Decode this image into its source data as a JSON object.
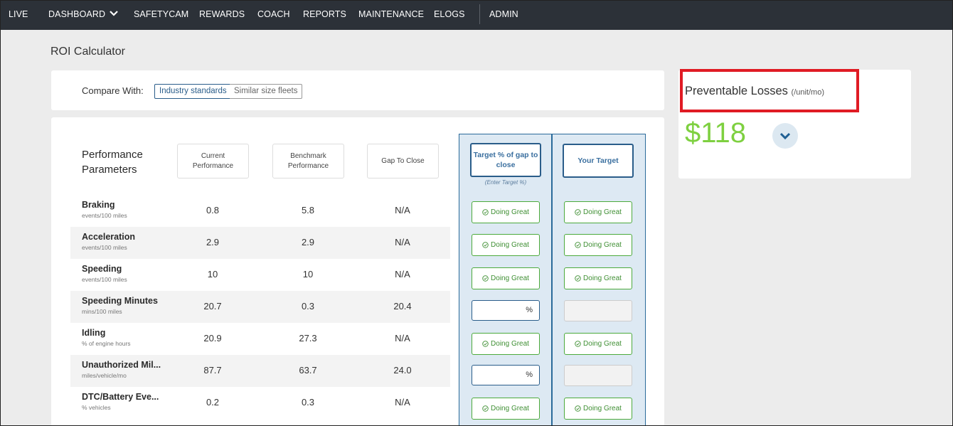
{
  "nav": {
    "items": [
      "LIVE",
      "DASHBOARD",
      "SAFETYCAM",
      "REWARDS",
      "COACH",
      "REPORTS",
      "MAINTENANCE",
      "ELOGS",
      "ADMIN"
    ],
    "dropdown_icon": "chevron-down-icon"
  },
  "page": {
    "title": "ROI Calculator"
  },
  "compare": {
    "label": "Compare With:",
    "options": [
      "Industry standards",
      "Similar size fleets"
    ],
    "selected": "Industry standards"
  },
  "table": {
    "title_line1": "Performance",
    "title_line2": "Parameters",
    "headers": {
      "current_line1": "Current",
      "current_line2": "Performance",
      "benchmark_line1": "Benchmark",
      "benchmark_line2": "Performance",
      "gap": "Gap To Close",
      "target_pct_line1": "Target % of gap to",
      "target_pct_line2": "close",
      "your_target": "Your Target"
    },
    "enter_target_hint": "(Enter Target %)",
    "status_label": "Doing Great",
    "pct_suffix": "%",
    "rows": [
      {
        "name": "Braking",
        "unit": "events/100 miles",
        "current": "0.8",
        "benchmark": "5.8",
        "gap": "N/A",
        "state": "great"
      },
      {
        "name": "Acceleration",
        "unit": "events/100 miles",
        "current": "2.9",
        "benchmark": "2.9",
        "gap": "N/A",
        "state": "great"
      },
      {
        "name": "Speeding",
        "unit": "events/100 miles",
        "current": "10",
        "benchmark": "10",
        "gap": "N/A",
        "state": "great"
      },
      {
        "name": "Speeding Minutes",
        "unit": "mins/100 miles",
        "current": "20.7",
        "benchmark": "0.3",
        "gap": "20.4",
        "state": "input"
      },
      {
        "name": "Idling",
        "unit": "% of engine hours",
        "current": "20.9",
        "benchmark": "27.3",
        "gap": "N/A",
        "state": "great"
      },
      {
        "name": "Unauthorized Mil...",
        "unit": "miles/vehicle/mo",
        "current": "87.7",
        "benchmark": "63.7",
        "gap": "24.0",
        "state": "input"
      },
      {
        "name": "DTC/Battery Eve...",
        "unit": "% vehicles",
        "current": "0.2",
        "benchmark": "0.3",
        "gap": "N/A",
        "state": "great"
      }
    ]
  },
  "losses": {
    "title": "Preventable Losses",
    "unit": "(/unit/mo)",
    "value": "$118",
    "value_color": "#7ed040",
    "expand_icon": "chevron-down-icon"
  },
  "colors": {
    "nav_bg": "#2c3138",
    "accent": "#2a5d8a",
    "success": "#4caa3c",
    "highlight": "#e01b24"
  }
}
